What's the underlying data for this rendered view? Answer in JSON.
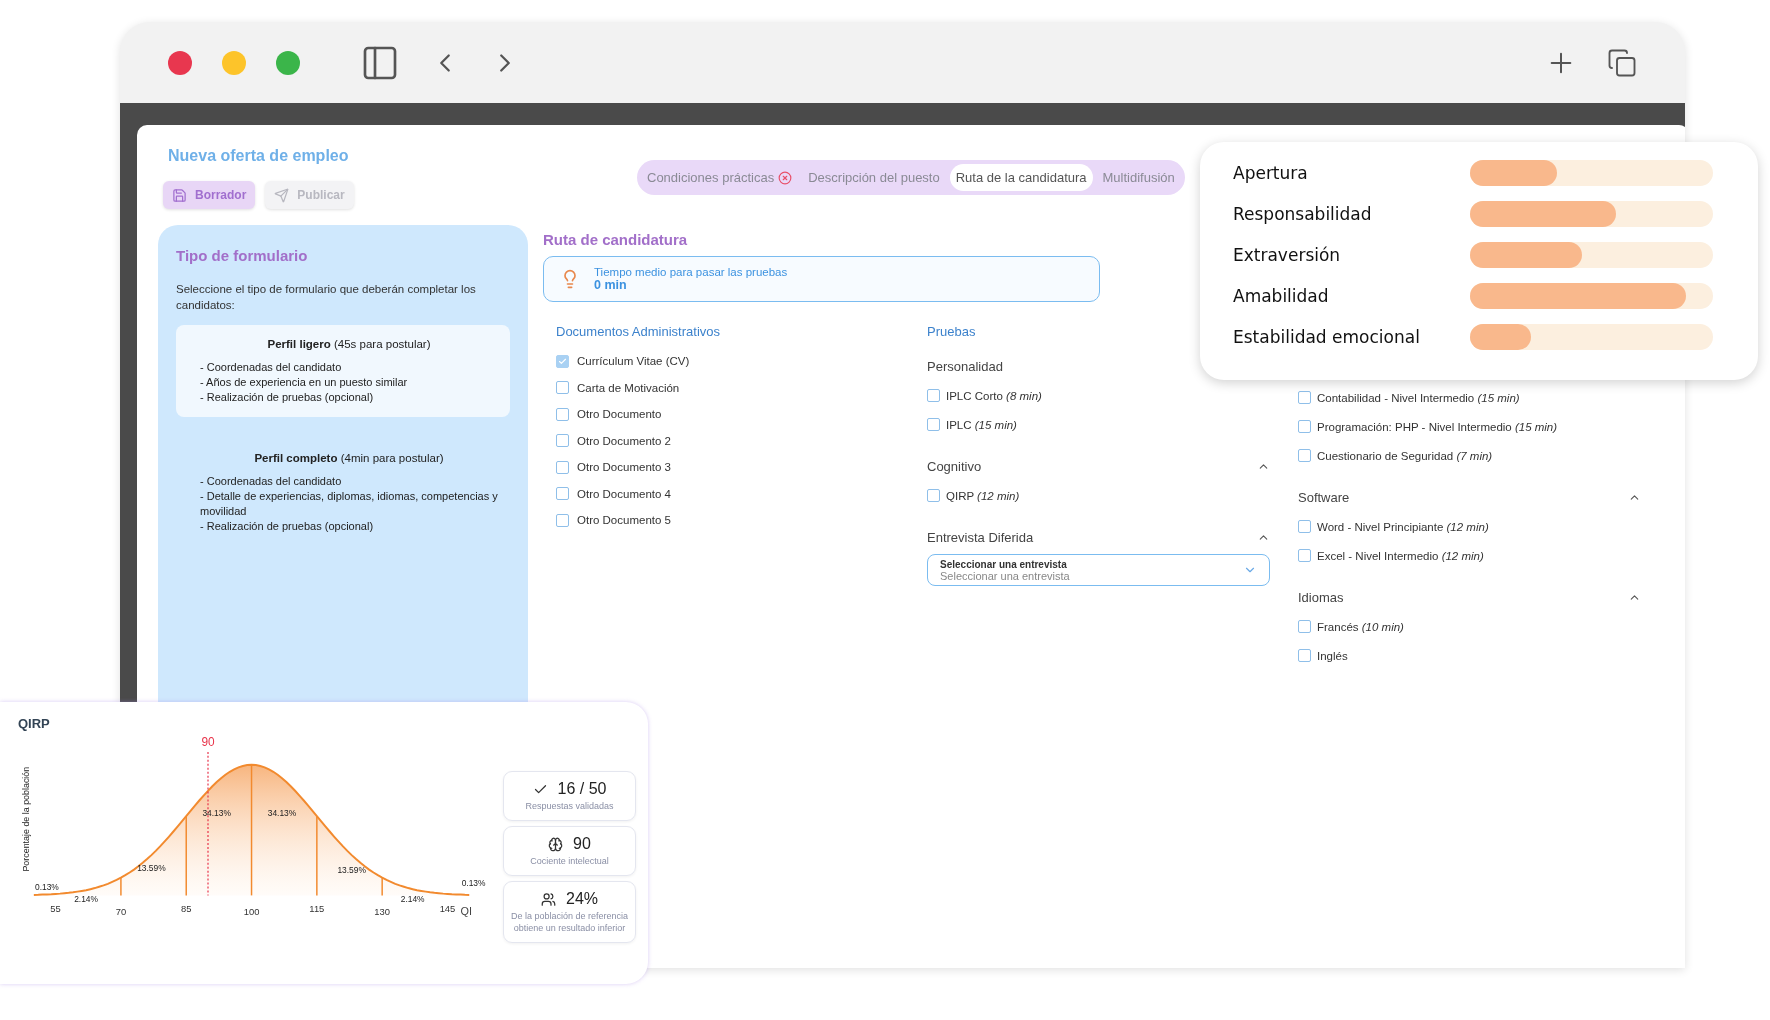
{
  "page": {
    "title": "Nueva oferta de empleo",
    "actions": [
      {
        "label": "Borrador",
        "kind": "save",
        "disabled": false
      },
      {
        "label": "Publicar",
        "kind": "send",
        "disabled": true
      }
    ]
  },
  "tabs": [
    {
      "label": "Condiciones prácticas",
      "selected": false,
      "error": true
    },
    {
      "label": "Descripción del puesto",
      "selected": false,
      "error": false
    },
    {
      "label": "Ruta de la candidatura",
      "selected": true,
      "error": false
    },
    {
      "label": "Multidifusión",
      "selected": false,
      "error": false
    }
  ],
  "form_type": {
    "title": "Tipo de formulario",
    "description": "Seleccione el tipo de formulario que deberán completar los candidatos:",
    "options": [
      {
        "heading": "**Perfil ligero** (45s para postular)",
        "selected": true,
        "items": [
          "- Coordenadas del candidato",
          "- Años de experiencia en un puesto similar",
          "- Realización de pruebas (opcional)"
        ]
      },
      {
        "heading": "**Perfil completo** (4min para postular)",
        "selected": false,
        "items": [
          "- Coordenadas del candidato",
          "- Detalle de experiencias, diplomas, idiomas, competencias y movilidad",
          "- Realización de pruebas (opcional)"
        ]
      }
    ]
  },
  "route": {
    "title": "Ruta de candidatura",
    "info": {
      "label": "Tiempo medio para pasar las pruebas",
      "value": "0 min"
    },
    "documents": {
      "title": "Documentos Administrativos",
      "items": [
        {
          "label": "Currículum Vitae (CV)",
          "checked": true
        },
        {
          "label": "Carta de Motivación",
          "checked": false
        },
        {
          "label": "Otro Documento",
          "checked": false
        },
        {
          "label": "Otro Documento 2",
          "checked": false
        },
        {
          "label": "Otro Documento 3",
          "checked": false
        },
        {
          "label": "Otro Documento 4",
          "checked": false
        },
        {
          "label": "Otro Documento 5",
          "checked": false
        }
      ]
    },
    "tests": {
      "title": "Pruebas",
      "sections": [
        {
          "title": "Personalidad",
          "kind": "checkboxes",
          "items": [
            {
              "label": "IPLC Corto *(8 min)*",
              "checked": false
            },
            {
              "label": "IPLC *(15 min)*",
              "checked": false
            }
          ]
        },
        {
          "title": "Cognitivo",
          "kind": "checkboxes",
          "expanded": true,
          "items": [
            {
              "label": "QIRP *(12 min)*",
              "checked": false
            }
          ]
        },
        {
          "title": "Entrevista Diferida",
          "kind": "select",
          "expanded": true,
          "select": {
            "label": "Seleccionar una entrevista",
            "placeholder": "Seleccionar una entrevista"
          }
        }
      ]
    },
    "column_3": {
      "sections": [
        {
          "kind": "checkboxes",
          "items": [
            {
              "label": "Contabilidad - Nivel Intermedio *(15 min)*",
              "checked": false
            },
            {
              "label": "Programación: PHP - Nivel Intermedio *(15 min)*",
              "checked": false
            },
            {
              "label": "Cuestionario de Seguridad *(7 min)*",
              "checked": false
            }
          ]
        },
        {
          "title": "Software",
          "kind": "checkboxes",
          "expanded": true,
          "items": [
            {
              "label": "Word - Nivel Principiante *(12 min)*",
              "checked": false
            },
            {
              "label": "Excel - Nivel Intermedio *(12 min)*",
              "checked": false
            }
          ]
        },
        {
          "title": "Idiomas",
          "kind": "checkboxes",
          "expanded": true,
          "items": [
            {
              "label": "Francés *(10 min)*",
              "checked": false
            },
            {
              "label": "Inglés",
              "checked": false
            }
          ]
        }
      ]
    }
  },
  "traits": [
    {
      "name": "Apertura",
      "level": 0.36
    },
    {
      "name": "Responsabilidad",
      "level": 0.6
    },
    {
      "name": "Extraversión",
      "level": 0.46
    },
    {
      "name": "Amabilidad",
      "level": 0.89
    },
    {
      "name": "Estabilidad emocional",
      "level": 0.25
    }
  ],
  "qirp": {
    "title": "QIRP",
    "ylabel": "Porcentaje de la población",
    "xlabel": "QI",
    "marker": "90",
    "ticks": [
      "55",
      "70",
      "85",
      "100",
      "115",
      "130",
      "145"
    ],
    "segments": [
      "0.13%",
      "2.14%",
      "13.59%",
      "34.13%",
      "34.13%",
      "13.59%",
      "2.14%",
      "0.13%"
    ],
    "stats": [
      {
        "kind": "check",
        "value": "16 / 50",
        "caption": "Respuestas validadas"
      },
      {
        "kind": "brain",
        "value": "90",
        "caption": "Cociente intelectual"
      },
      {
        "kind": "people",
        "value": "24%",
        "caption": "De la población de referencia obtiene un resultado inferior"
      }
    ]
  }
}
